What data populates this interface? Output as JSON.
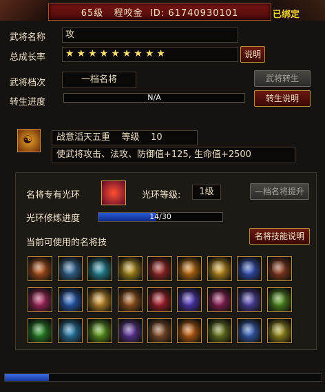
{
  "header": {
    "level": "65级",
    "name": "程咬金",
    "id_label": "ID:",
    "id": "61740930101",
    "bound": "已绑定"
  },
  "general": {
    "name_label": "武将名称",
    "name_value": "攻",
    "growth_label": "总成长率",
    "growth_stars": "★★★★★★★★★",
    "explain_btn": "说明",
    "grade_label": "武将档次",
    "grade_value": "一档名将",
    "rebirth_btn": "武将转生",
    "rebirth_progress_label": "转生进度",
    "rebirth_progress_value": "N/A",
    "rebirth_explain_btn": "转生说明"
  },
  "buff": {
    "name": "战意滔天五重",
    "level_label": "等级",
    "level_value": "10",
    "description": "使武将攻击、法攻、防御值+125, 生命值+2500"
  },
  "halo": {
    "label": "名将专有光环",
    "level_label": "光环等级:",
    "level_value": "1级",
    "upgrade_btn": "一档名将提升",
    "train_label": "光环修炼进度",
    "train_text": "14/30",
    "train_progress": 0.467,
    "skills_label": "当前可使用的名将技",
    "skills_btn": "名将技能说明"
  },
  "skills": [
    {
      "name": "axe-skill-icon",
      "color": "#c85a1a"
    },
    {
      "name": "hammer-skill-icon",
      "color": "#3a7ab0"
    },
    {
      "name": "wind-skill-icon",
      "color": "#2a9ab0"
    },
    {
      "name": "blade-skill-icon",
      "color": "#c8a020"
    },
    {
      "name": "slash-skill-icon",
      "color": "#b02a2a"
    },
    {
      "name": "fire-claw-skill-icon",
      "color": "#d87a10"
    },
    {
      "name": "flame-sword-skill-icon",
      "color": "#d8a020"
    },
    {
      "name": "lightning-skill-icon",
      "color": "#3a5ad0"
    },
    {
      "name": "warrior-skill-icon",
      "color": "#a04020"
    },
    {
      "name": "wing-skill-icon",
      "color": "#c02a6a"
    },
    {
      "name": "dragon-skill-icon",
      "color": "#2a6ad0"
    },
    {
      "name": "burst-skill-icon",
      "color": "#e0a030"
    },
    {
      "name": "beast-skill-icon",
      "color": "#b06020"
    },
    {
      "name": "heart-skill-icon",
      "color": "#c02030"
    },
    {
      "name": "vortex-skill-icon",
      "color": "#5a3ad0"
    },
    {
      "name": "demon-skill-icon",
      "color": "#a02060"
    },
    {
      "name": "rune-skill-icon",
      "color": "#5a4ac0"
    },
    {
      "name": "nature-skill-icon",
      "color": "#5aa020"
    },
    {
      "name": "tree-skill-icon",
      "color": "#2a9a2a"
    },
    {
      "name": "spirit-skill-icon",
      "color": "#2a8ac0"
    },
    {
      "name": "venom-skill-icon",
      "color": "#6ab020"
    },
    {
      "name": "mage-skill-icon",
      "color": "#6a3ab0"
    },
    {
      "name": "pillar-skill-icon",
      "color": "#9a5a30"
    },
    {
      "name": "inferno-skill-icon",
      "color": "#d86a10"
    },
    {
      "name": "bow-skill-icon",
      "color": "#7a8a20"
    },
    {
      "name": "storm-skill-icon",
      "color": "#3a6ad0"
    },
    {
      "name": "guardian-skill-icon",
      "color": "#b0a020"
    }
  ]
}
